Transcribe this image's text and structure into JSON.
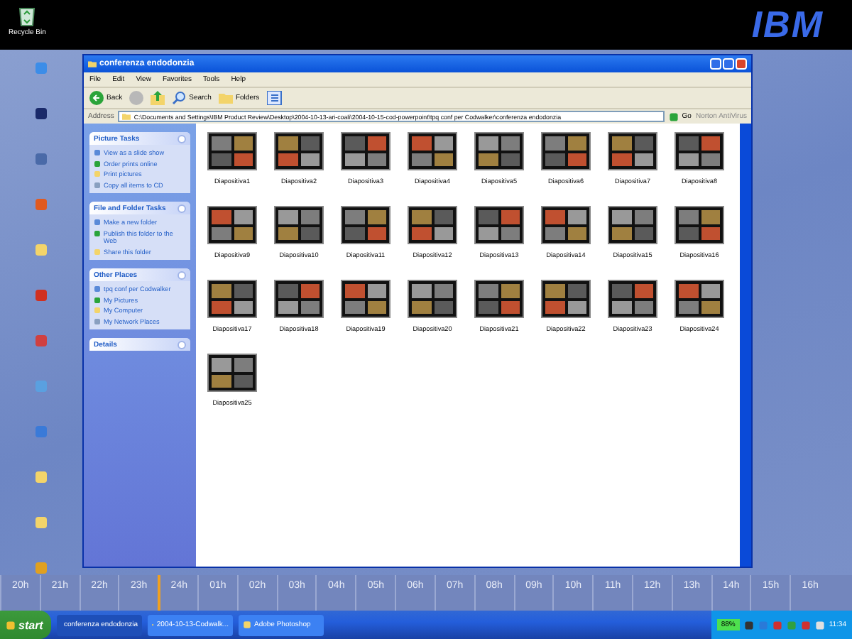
{
  "desktop": {
    "top_icon": "Recycle Bin",
    "logo": "IBM"
  },
  "window": {
    "title": "conferenza endodonzia",
    "menu": [
      "File",
      "Edit",
      "View",
      "Favorites",
      "Tools",
      "Help"
    ],
    "toolbar": [
      {
        "kind": "back",
        "label": "Back"
      },
      {
        "kind": "forward"
      },
      {
        "kind": "up"
      },
      {
        "kind": "search",
        "label": "Search"
      },
      {
        "kind": "folders",
        "label": "Folders"
      },
      {
        "kind": "views"
      }
    ],
    "address": {
      "label": "Address",
      "value": "C:\\Documents and Settings\\IBM Product Review\\Desktop\\2004-10-13-ari-coali\\2004-10-15-cod-powerpoint\\tpq conf per Codwalker\\conferenza endodonzia",
      "go": "Go",
      "extra": "Norton AntiVirus"
    },
    "sections": [
      {
        "title": "Picture Tasks",
        "items": [
          "View as a slide show",
          "Order prints online",
          "Print pictures",
          "Copy all items to CD"
        ]
      },
      {
        "title": "File and Folder Tasks",
        "items": [
          "Make a new folder",
          "Publish this folder to the Web",
          "Share this folder"
        ]
      },
      {
        "title": "Other Places",
        "items": [
          "tpq conf per Codwalker",
          "My Pictures",
          "My Computer",
          "My Network Places"
        ]
      },
      {
        "title": "Details"
      }
    ],
    "files": [
      "Diapositiva1",
      "Diapositiva2",
      "Diapositiva3",
      "Diapositiva4",
      "Diapositiva5",
      "Diapositiva6",
      "Diapositiva7",
      "Diapositiva8",
      "Diapositiva9",
      "Diapositiva10",
      "Diapositiva11",
      "Diapositiva12",
      "Diapositiva13",
      "Diapositiva14",
      "Diapositiva15",
      "Diapositiva16",
      "Diapositiva17",
      "Diapositiva18",
      "Diapositiva19",
      "Diapositiva20",
      "Diapositiva21",
      "Diapositiva22",
      "Diapositiva23",
      "Diapositiva24",
      "Diapositiva25"
    ]
  },
  "timeline": {
    "hours": [
      {
        "label": "20h",
        "current": false
      },
      {
        "label": "21h",
        "current": false
      },
      {
        "label": "22h",
        "current": false
      },
      {
        "label": "23h",
        "current": false
      },
      {
        "label": "24h",
        "current": true
      },
      {
        "label": "01h",
        "current": false
      },
      {
        "label": "02h",
        "current": false
      },
      {
        "label": "03h",
        "current": false
      },
      {
        "label": "04h",
        "current": false
      },
      {
        "label": "05h",
        "current": false
      },
      {
        "label": "06h",
        "current": false
      },
      {
        "label": "07h",
        "current": false
      },
      {
        "label": "08h",
        "current": false
      },
      {
        "label": "09h",
        "current": false
      },
      {
        "label": "10h",
        "current": false
      },
      {
        "label": "11h",
        "current": false
      },
      {
        "label": "12h",
        "current": false
      },
      {
        "label": "13h",
        "current": false
      },
      {
        "label": "14h",
        "current": false
      },
      {
        "label": "15h",
        "current": false
      },
      {
        "label": "16h",
        "current": false
      }
    ]
  },
  "taskbar": {
    "start": "start",
    "tasks": [
      {
        "label": "conferenza endodonzia",
        "selected": true
      },
      {
        "label": "2004-10-13-Codwalk...",
        "selected": false
      },
      {
        "label": "Adobe Photoshop",
        "selected": false
      }
    ],
    "battery": "88%",
    "clock": "11:34"
  }
}
